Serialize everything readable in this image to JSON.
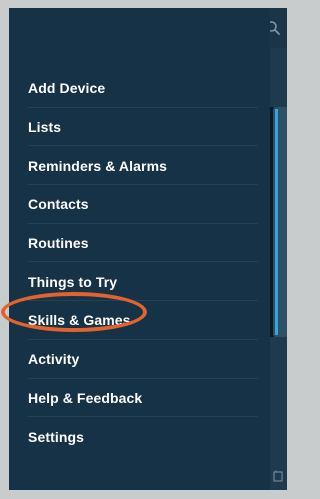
{
  "drawer": {
    "items": [
      {
        "label": "Add Device"
      },
      {
        "label": "Lists"
      },
      {
        "label": "Reminders & Alarms"
      },
      {
        "label": "Contacts"
      },
      {
        "label": "Routines"
      },
      {
        "label": "Things to Try"
      },
      {
        "label": "Skills & Games"
      },
      {
        "label": "Activity"
      },
      {
        "label": "Help & Feedback"
      },
      {
        "label": "Settings"
      }
    ],
    "highlighted_item": "Skills & Games"
  },
  "colors": {
    "drawer_bg": "#163246",
    "app_bg": "#1d3a4f",
    "frame_bg": "#c9cccd",
    "highlight_ring": "#e2632c",
    "card_accent": "#34a7d9"
  },
  "icons": [
    "search-icon",
    "bottom-nav-icon"
  ]
}
